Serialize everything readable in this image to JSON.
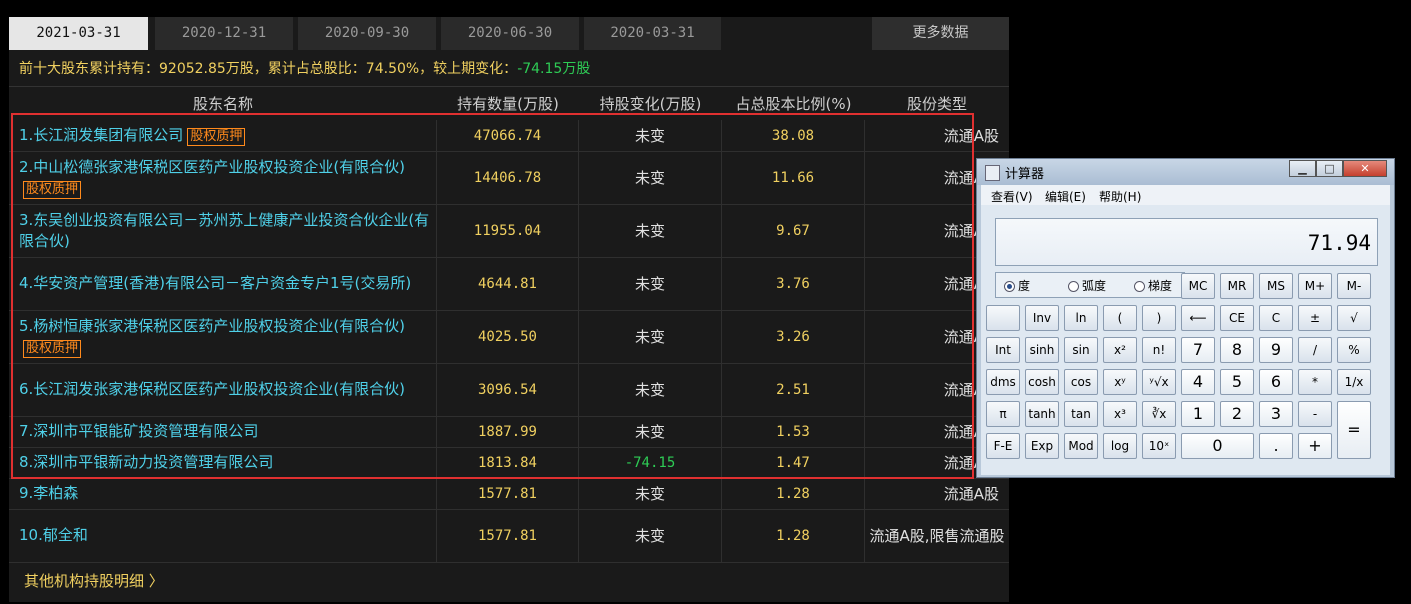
{
  "tabs": [
    "2021-03-31",
    "2020-12-31",
    "2020-09-30",
    "2020-06-30",
    "2020-03-31"
  ],
  "more_label": "更多数据",
  "summary": {
    "prefix": "前十大股东累计持有：92052.85万股，累计占总股比：74.50%，较上期变化：",
    "change": "-74.15万股"
  },
  "headers": [
    "股东名称",
    "持有数量(万股)",
    "持股变化(万股)",
    "占总股本比例(%)",
    "股份类型"
  ],
  "rows": [
    {
      "name": "1.长江润发集团有限公司",
      "badge": "股权质押",
      "qty": "47066.74",
      "chg": "未变",
      "pct": "38.08",
      "type": "流通A股"
    },
    {
      "name": "2.中山松德张家港保税区医药产业股权投资企业(有限合伙)",
      "badge": "股权质押",
      "qty": "14406.78",
      "chg": "未变",
      "pct": "11.66",
      "type": "流通A股"
    },
    {
      "name": "3.东吴创业投资有限公司－苏州苏上健康产业投资合伙企业(有限合伙)",
      "badge": "",
      "qty": "11955.04",
      "chg": "未变",
      "pct": "9.67",
      "type": "流通A股"
    },
    {
      "name": "4.华安资产管理(香港)有限公司－客户资金专户1号(交易所)",
      "badge": "",
      "qty": "4644.81",
      "chg": "未变",
      "pct": "3.76",
      "type": "流通A股"
    },
    {
      "name": "5.杨树恒康张家港保税区医药产业股权投资企业(有限合伙)",
      "badge": "股权质押",
      "qty": "4025.50",
      "chg": "未变",
      "pct": "3.26",
      "type": "流通A股"
    },
    {
      "name": "6.长江润发张家港保税区医药产业股权投资企业(有限合伙)",
      "badge": "",
      "qty": "3096.54",
      "chg": "未变",
      "pct": "2.51",
      "type": "流通A股"
    },
    {
      "name": "7.深圳市平银能矿投资管理有限公司",
      "badge": "",
      "qty": "1887.99",
      "chg": "未变",
      "pct": "1.53",
      "type": "流通A股"
    },
    {
      "name": "8.深圳市平银新动力投资管理有限公司",
      "badge": "",
      "qty": "1813.84",
      "chg": "-74.15",
      "pct": "1.47",
      "type": "流通A股"
    },
    {
      "name": "9.李柏森",
      "badge": "",
      "qty": "1577.81",
      "chg": "未变",
      "pct": "1.28",
      "type": "流通A股"
    },
    {
      "name": "10.郁全和",
      "badge": "",
      "qty": "1577.81",
      "chg": "未变",
      "pct": "1.28",
      "type": "流通A股,限售流通股"
    }
  ],
  "footer": "其他机构持股明细 〉",
  "calculator": {
    "title": "计算器",
    "menu": [
      "查看(V)",
      "编辑(E)",
      "帮助(H)"
    ],
    "display": "71.94",
    "angle_modes": [
      "度",
      "弧度",
      "梯度"
    ],
    "selected_mode": "度",
    "keys": [
      [
        "MC",
        "MR",
        "MS",
        "M+",
        "M-"
      ],
      [
        "",
        "Inv",
        "ln",
        "(",
        ")",
        "⟵",
        "CE",
        "C",
        "±",
        "√"
      ],
      [
        "Int",
        "sinh",
        "sin",
        "x²",
        "n!",
        "7",
        "8",
        "9",
        "/",
        "%"
      ],
      [
        "dms",
        "cosh",
        "cos",
        "xʸ",
        "ʸ√x",
        "4",
        "5",
        "6",
        "*",
        "1/x"
      ],
      [
        "π",
        "tanh",
        "tan",
        "x³",
        "∛x",
        "1",
        "2",
        "3",
        "-",
        "="
      ],
      [
        "F-E",
        "Exp",
        "Mod",
        "log",
        "10ˣ",
        "0",
        ".",
        "+"
      ]
    ]
  }
}
